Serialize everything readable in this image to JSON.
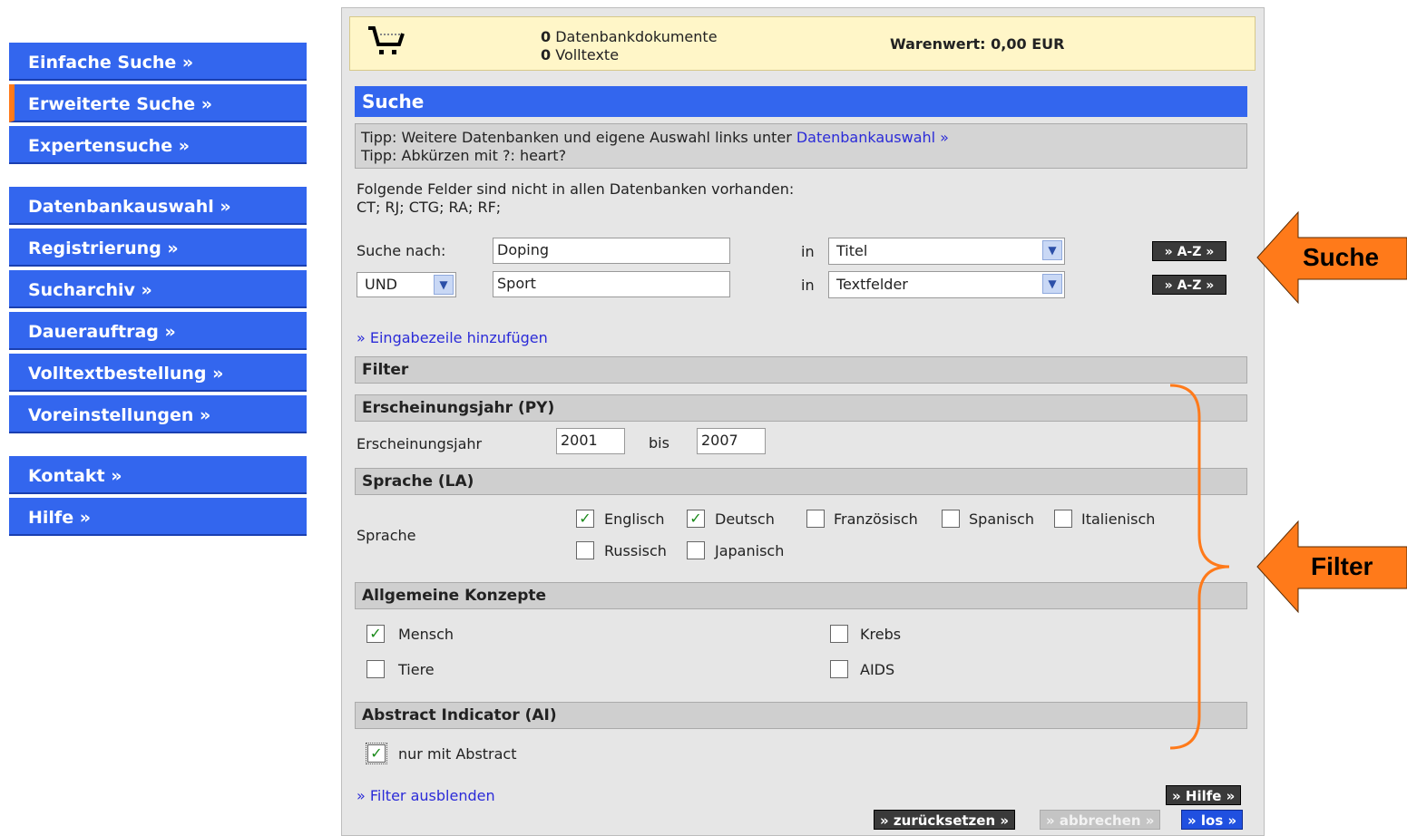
{
  "sidebar": {
    "items": [
      {
        "label": "Einfache Suche »"
      },
      {
        "label": "Erweiterte Suche »"
      },
      {
        "label": "Expertensuche »"
      },
      {
        "label": "Datenbankauswahl »"
      },
      {
        "label": "Registrierung »"
      },
      {
        "label": "Sucharchiv »"
      },
      {
        "label": "Dauerauftrag »"
      },
      {
        "label": "Volltextbestellung »"
      },
      {
        "label": "Voreinstellungen »"
      },
      {
        "label": "Kontakt »"
      },
      {
        "label": "Hilfe »"
      }
    ]
  },
  "cart": {
    "db_count": "0",
    "db_label": "Datenbankdokumente",
    "fulltext_count": "0",
    "fulltext_label": "Volltexte",
    "value": "Warenwert: 0,00 EUR"
  },
  "search": {
    "title": "Suche",
    "tip1_prefix": "Tipp: Weitere Datenbanken und eigene Auswahl links unter ",
    "tip1_link": "Datenbankauswahl »",
    "tip2": "Tipp: Abkürzen mit ?: heart?",
    "note_line1": "Folgende Felder sind nicht in allen Datenbanken vorhanden:",
    "note_line2": "CT; RJ; CTG; RA; RF;",
    "search_for_label": "Suche nach:",
    "row1_value": "Doping",
    "in_label": "in",
    "row1_field": "Titel",
    "az_label": "» A-Z »",
    "row2_operator": "UND",
    "row2_value": "Sport",
    "row2_field": "Textfelder",
    "add_row_link": "» Eingabezeile hinzufügen"
  },
  "filter": {
    "title": "Filter",
    "year_section": "Erscheinungsjahr (PY)",
    "year_label": "Erscheinungsjahr",
    "year_from": "2001",
    "year_to_label": "bis",
    "year_to": "2007",
    "lang_section": "Sprache (LA)",
    "lang_label": "Sprache",
    "languages": [
      {
        "label": "Englisch",
        "checked": true
      },
      {
        "label": "Deutsch",
        "checked": true
      },
      {
        "label": "Französisch",
        "checked": false
      },
      {
        "label": "Spanisch",
        "checked": false
      },
      {
        "label": "Italienisch",
        "checked": false
      },
      {
        "label": "Russisch",
        "checked": false
      },
      {
        "label": "Japanisch",
        "checked": false
      }
    ],
    "concepts_section": "Allgemeine Konzepte",
    "concepts": [
      {
        "label": "Mensch",
        "checked": true
      },
      {
        "label": "Krebs",
        "checked": false
      },
      {
        "label": "Tiere",
        "checked": false
      },
      {
        "label": "AIDS",
        "checked": false
      }
    ],
    "abstract_section": "Abstract Indicator (AI)",
    "abstract_label": "nur mit Abstract",
    "abstract_checked": true,
    "hide_link": "» Filter ausblenden"
  },
  "buttons": {
    "help": "» Hilfe »",
    "reset": "» zurücksetzen »",
    "cancel": "» abbrechen »",
    "go": "» los »"
  },
  "callouts": {
    "search": "Suche",
    "filter": "Filter",
    "arrow_color": "#ff7a1a"
  },
  "colors": {
    "nav_blue": "#3366ee",
    "active_marker": "#ff7a1a",
    "cart_bg": "#fff6c8",
    "panel_bg": "#e6e6e6"
  }
}
